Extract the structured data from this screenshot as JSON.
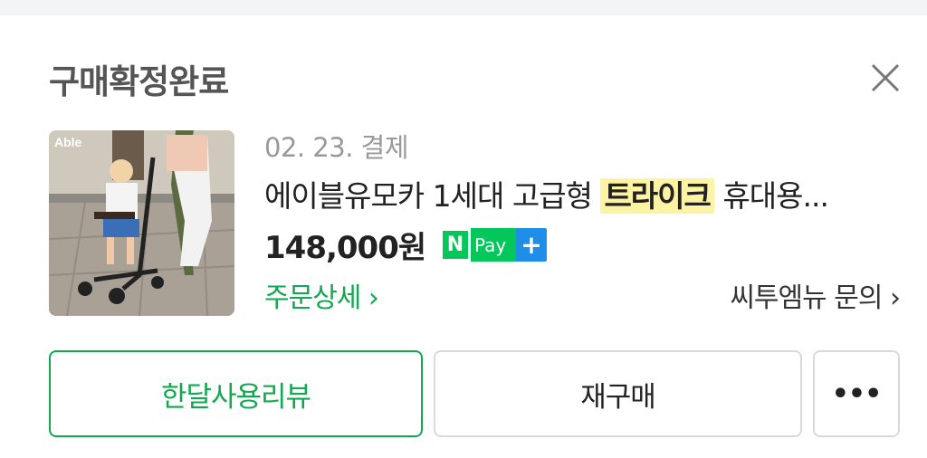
{
  "order": {
    "status": "구매확정완료",
    "date": "02. 23. 결제",
    "product_name_before": "에이블유모카 1세대 고급형 ",
    "product_name_highlight": "트라이크",
    "product_name_after": " 휴대용...",
    "price": "148,000원",
    "payment_badge": {
      "mark": "N",
      "label": "Pay",
      "plus": "+"
    },
    "thumbnail_brand": "Able"
  },
  "links": {
    "order_detail": "주문상세 ›",
    "seller_inquiry": "씨투엠뉴 문의 ›"
  },
  "actions": {
    "review": "한달사용리뷰",
    "rebuy": "재구매",
    "more": "•••"
  },
  "colors": {
    "accent": "#12a84f",
    "highlight": "#fdf4a3",
    "npay_green": "#03c75a",
    "npay_blue": "#1e8ee8"
  },
  "icons": {
    "close": "close-icon",
    "more": "more-icon"
  }
}
